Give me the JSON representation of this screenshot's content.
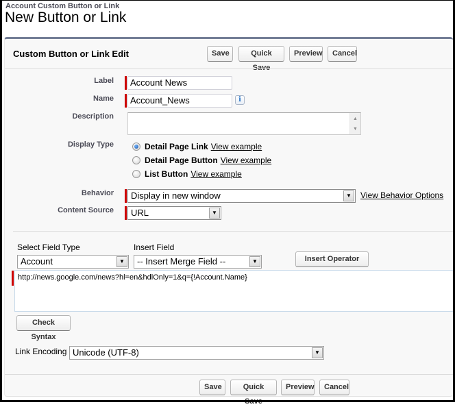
{
  "header": {
    "breadcrumb": "Account Custom Button or Link",
    "title": "New Button or Link"
  },
  "panel": {
    "title": "Custom Button or Link Edit",
    "buttons": {
      "save": "Save",
      "quick_save": "Quick Save",
      "preview": "Preview",
      "cancel": "Cancel"
    }
  },
  "form": {
    "label": {
      "label": "Label",
      "value": "Account News"
    },
    "name": {
      "label": "Name",
      "value": "Account_News",
      "info_icon": "i"
    },
    "description": {
      "label": "Description",
      "value": ""
    },
    "display_type": {
      "label": "Display Type",
      "options": [
        {
          "label": "Detail Page Link",
          "link": "View example",
          "checked": true
        },
        {
          "label": "Detail Page Button",
          "link": "View example",
          "checked": false
        },
        {
          "label": "List Button",
          "link": "View example",
          "checked": false
        }
      ]
    },
    "behavior": {
      "label": "Behavior",
      "value": "Display in new window",
      "link": "View Behavior Options"
    },
    "content_source": {
      "label": "Content Source",
      "value": "URL"
    }
  },
  "editor": {
    "select_field_type": {
      "label": "Select Field Type",
      "value": "Account"
    },
    "insert_field": {
      "label": "Insert Field",
      "value": "-- Insert Merge Field --"
    },
    "insert_operator": "Insert Operator",
    "formula": "http://news.google.com/news?hl=en&hdlOnly=1&q={!Account.Name}",
    "check_syntax": "Check Syntax",
    "link_encoding": {
      "label": "Link Encoding",
      "value": "Unicode (UTF-8)"
    }
  },
  "icons": {
    "dropdown": "▼",
    "scroll_up": "▲",
    "scroll_down": "▼"
  },
  "colors": {
    "required_bar": "#cc0000",
    "panel_top_border": "#747e96",
    "panel_bg": "#f8f8f8"
  }
}
